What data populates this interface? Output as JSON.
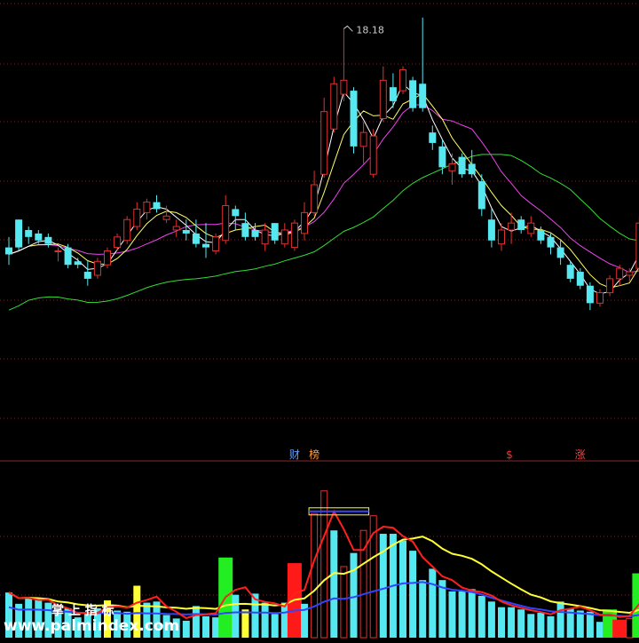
{
  "chart_data": [
    {
      "type": "candlestick",
      "panel": "price",
      "annotations": {
        "high_label": "18.18",
        "high_value": 18.18
      },
      "markers": [
        {
          "label": "财",
          "index": 29,
          "color": "#5fa0ff"
        },
        {
          "label": "榜",
          "index": 31,
          "color": "#ff9a3c"
        },
        {
          "label": "$",
          "index": 51,
          "color": "#ff3030"
        },
        {
          "label": "涨",
          "index": 58,
          "color": "#ff4040"
        }
      ],
      "ylim": [
        8.6,
        18.8
      ],
      "candles": [
        [
          11.9,
          12.2,
          11.4,
          11.7
        ],
        [
          12.7,
          12.7,
          11.8,
          11.9
        ],
        [
          12.4,
          12.5,
          12.0,
          12.2
        ],
        [
          12.3,
          12.4,
          12.0,
          12.1
        ],
        [
          12.2,
          12.3,
          11.9,
          12.0
        ],
        [
          11.8,
          11.9,
          11.5,
          11.8
        ],
        [
          11.9,
          12.0,
          11.3,
          11.4
        ],
        [
          11.5,
          11.6,
          11.3,
          11.4
        ],
        [
          11.2,
          11.5,
          10.8,
          11.0
        ],
        [
          11.1,
          11.6,
          11.0,
          11.5
        ],
        [
          11.4,
          11.9,
          11.3,
          11.8
        ],
        [
          11.9,
          12.3,
          11.8,
          12.2
        ],
        [
          12.1,
          12.8,
          12.0,
          12.7
        ],
        [
          12.5,
          13.2,
          12.4,
          13.0
        ],
        [
          12.9,
          13.3,
          12.7,
          13.2
        ],
        [
          13.2,
          13.4,
          12.9,
          13.0
        ],
        [
          12.7,
          13.1,
          12.6,
          12.8
        ],
        [
          12.4,
          12.7,
          12.2,
          12.5
        ],
        [
          12.4,
          12.7,
          12.1,
          12.3
        ],
        [
          12.3,
          12.7,
          11.9,
          12.0
        ],
        [
          12.0,
          12.6,
          11.6,
          11.9
        ],
        [
          11.8,
          12.3,
          11.7,
          12.2
        ],
        [
          12.1,
          13.4,
          12.0,
          13.1
        ],
        [
          13.0,
          13.1,
          12.4,
          12.8
        ],
        [
          12.6,
          12.9,
          12.1,
          12.2
        ],
        [
          12.4,
          12.6,
          12.1,
          12.2
        ],
        [
          12.0,
          12.6,
          11.8,
          12.4
        ],
        [
          12.6,
          12.6,
          12.0,
          12.1
        ],
        [
          12.0,
          12.6,
          11.9,
          12.4
        ],
        [
          11.9,
          12.7,
          11.8,
          12.6
        ],
        [
          12.3,
          13.2,
          12.1,
          12.9
        ],
        [
          12.9,
          14.1,
          12.8,
          13.7
        ],
        [
          14.0,
          16.2,
          13.9,
          15.8
        ],
        [
          15.3,
          16.8,
          15.2,
          16.6
        ],
        [
          16.3,
          18.18,
          16.1,
          16.7
        ],
        [
          16.4,
          16.5,
          14.6,
          14.8
        ],
        [
          14.8,
          15.5,
          14.3,
          15.2
        ],
        [
          14.0,
          15.3,
          13.9,
          15.1
        ],
        [
          15.6,
          17.1,
          15.5,
          16.7
        ],
        [
          16.5,
          16.9,
          15.9,
          16.1
        ],
        [
          16.4,
          17.1,
          16.3,
          17.0
        ],
        [
          16.7,
          16.8,
          15.8,
          15.9
        ],
        [
          16.6,
          18.5,
          15.8,
          15.9
        ],
        [
          15.2,
          15.4,
          14.7,
          14.9
        ],
        [
          14.8,
          15.0,
          14.0,
          14.2
        ],
        [
          14.1,
          14.6,
          13.7,
          14.3
        ],
        [
          14.5,
          14.6,
          13.9,
          14.0
        ],
        [
          14.3,
          14.7,
          13.9,
          14.0
        ],
        [
          13.8,
          14.0,
          12.8,
          13.0
        ],
        [
          12.7,
          13.0,
          11.9,
          12.1
        ],
        [
          12.0,
          12.6,
          11.8,
          12.4
        ],
        [
          12.4,
          12.9,
          12.0,
          12.6
        ],
        [
          12.7,
          12.8,
          12.3,
          12.4
        ],
        [
          12.3,
          12.8,
          12.2,
          12.6
        ],
        [
          12.4,
          12.5,
          12.0,
          12.1
        ],
        [
          12.2,
          12.3,
          11.7,
          11.9
        ],
        [
          11.9,
          12.1,
          11.4,
          11.6
        ],
        [
          11.4,
          11.5,
          10.9,
          11.0
        ],
        [
          11.2,
          11.3,
          10.7,
          10.8
        ],
        [
          10.8,
          10.9,
          10.1,
          10.3
        ],
        [
          10.3,
          10.7,
          10.2,
          10.6
        ],
        [
          10.6,
          11.1,
          10.5,
          11.0
        ],
        [
          11.0,
          11.4,
          10.8,
          11.3
        ],
        [
          11.1,
          11.3,
          10.9,
          11.2
        ],
        [
          11.3,
          12.8,
          11.2,
          12.6
        ]
      ]
    },
    {
      "type": "bar",
      "panel": "volume",
      "bars": [
        {
          "v": 4.0,
          "c": "cyan"
        },
        {
          "v": 3.0,
          "c": "cyan"
        },
        {
          "v": 3.6,
          "c": "cyan"
        },
        {
          "v": 3.4,
          "c": "cyan"
        },
        {
          "v": 3.1,
          "c": "cyan"
        },
        {
          "v": 2.1,
          "c": "cyan"
        },
        {
          "v": 2.6,
          "c": "cyan"
        },
        {
          "v": 1.8,
          "c": "cyan"
        },
        {
          "v": 2.2,
          "c": "cyan"
        },
        {
          "v": 2.6,
          "c": "cyan"
        },
        {
          "v": 3.3,
          "c": "yellow"
        },
        {
          "v": 2.4,
          "c": "cyan"
        },
        {
          "v": 2.3,
          "c": "cyan"
        },
        {
          "v": 4.6,
          "c": "yellow"
        },
        {
          "v": 3.1,
          "c": "cyan"
        },
        {
          "v": 3.2,
          "c": "cyan"
        },
        {
          "v": 2.0,
          "c": "cyan"
        },
        {
          "v": 1.7,
          "c": "cyan"
        },
        {
          "v": 1.5,
          "c": "cyan"
        },
        {
          "v": 2.8,
          "c": "cyan"
        },
        {
          "v": 1.9,
          "c": "cyan"
        },
        {
          "v": 1.8,
          "c": "cyan"
        },
        {
          "v": 7.1,
          "c": "green"
        },
        {
          "v": 3.8,
          "c": "cyan"
        },
        {
          "v": 2.5,
          "c": "yellow"
        },
        {
          "v": 3.9,
          "c": "cyan"
        },
        {
          "v": 3.1,
          "c": "cyan"
        },
        {
          "v": 2.1,
          "c": "cyan"
        },
        {
          "v": 3.1,
          "c": "cyan"
        },
        {
          "v": 6.6,
          "c": "red"
        },
        {
          "v": 3.0,
          "c": "cyan"
        },
        {
          "v": 11.0,
          "c": "outline"
        },
        {
          "v": 13.0,
          "c": "outline"
        },
        {
          "v": 9.5,
          "c": "cyan"
        },
        {
          "v": 6.3,
          "c": "outline"
        },
        {
          "v": 7.5,
          "c": "cyan"
        },
        {
          "v": 9.5,
          "c": "outline"
        },
        {
          "v": 10.8,
          "c": "outline"
        },
        {
          "v": 9.2,
          "c": "cyan"
        },
        {
          "v": 9.2,
          "c": "cyan"
        },
        {
          "v": 8.6,
          "c": "cyan"
        },
        {
          "v": 7.7,
          "c": "cyan"
        },
        {
          "v": 5.1,
          "c": "cyan"
        },
        {
          "v": 6.1,
          "c": "cyan"
        },
        {
          "v": 5.1,
          "c": "cyan"
        },
        {
          "v": 4.1,
          "c": "cyan"
        },
        {
          "v": 4.1,
          "c": "cyan"
        },
        {
          "v": 4.3,
          "c": "cyan"
        },
        {
          "v": 3.7,
          "c": "cyan"
        },
        {
          "v": 3.2,
          "c": "cyan"
        },
        {
          "v": 2.7,
          "c": "cyan"
        },
        {
          "v": 2.7,
          "c": "cyan"
        },
        {
          "v": 2.5,
          "c": "cyan"
        },
        {
          "v": 2.1,
          "c": "cyan"
        },
        {
          "v": 2.2,
          "c": "cyan"
        },
        {
          "v": 1.9,
          "c": "cyan"
        },
        {
          "v": 3.2,
          "c": "cyan"
        },
        {
          "v": 2.6,
          "c": "cyan"
        },
        {
          "v": 2.4,
          "c": "cyan"
        },
        {
          "v": 2.3,
          "c": "cyan"
        },
        {
          "v": 1.4,
          "c": "cyan"
        },
        {
          "v": 2.5,
          "c": "green"
        },
        {
          "v": 1.6,
          "c": "red"
        },
        {
          "v": 1.7,
          "c": "outline"
        },
        {
          "v": 5.7,
          "c": "green"
        }
      ],
      "top_box": {
        "start_index": 31,
        "end_index": 36
      },
      "ylim": [
        0,
        14
      ]
    }
  ],
  "watermark": {
    "title": "掌 上 指 标",
    "url": "www.palmindex.com"
  },
  "colors": {
    "background": "#000000",
    "up": "#e03030",
    "down": "#55e8f0",
    "ma5": "#ffffff",
    "ma10": "#ffff66",
    "ma20": "#ee44ee",
    "ma60": "#33dd33",
    "vol_ma_red": "#ff2020",
    "vol_ma_yellow": "#ffff33",
    "vol_ma_blue": "#3344ff",
    "vol_yellow": "#ffff33",
    "vol_green": "#22ee22",
    "vol_red": "#ff1a1a",
    "grid": "#6a2a2a"
  }
}
